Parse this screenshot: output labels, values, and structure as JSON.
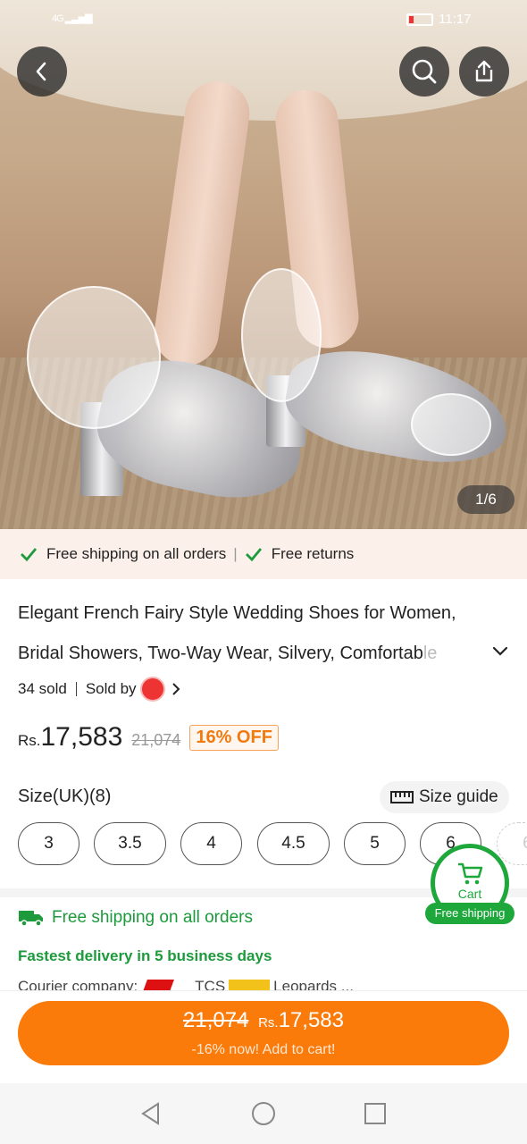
{
  "status_bar": {
    "network": "4G",
    "time": "11:17"
  },
  "gallery": {
    "counter": "1/6"
  },
  "benefits": {
    "shipping": "Free shipping on all orders",
    "separator": "|",
    "returns": "Free returns"
  },
  "product": {
    "title_line1": "Elegant French Fairy Style Wedding Shoes for Women,",
    "title_line2_main": "Bridal Showers, Two-Way Wear, Silvery, Comfortab",
    "title_line2_fade": "le",
    "sold": "34 sold",
    "sold_by": "Sold by"
  },
  "price": {
    "currency": "Rs.",
    "current": "17,583",
    "original": "21,074",
    "discount": "16% OFF"
  },
  "size": {
    "label": "Size(UK)(8)",
    "guide": "Size guide",
    "options": [
      "3",
      "3.5",
      "4",
      "4.5",
      "5",
      "6",
      "6"
    ]
  },
  "shipping": {
    "free": "Free shipping on all orders",
    "fastest": "Fastest delivery in 5 business days",
    "courier_label": "Courier company:",
    "courier_tcs": "TCS",
    "courier_leopards": "Leopards ..."
  },
  "cart_fab": {
    "label": "Cart",
    "badge": "Free shipping"
  },
  "cta": {
    "original": "21,074",
    "currency": "Rs.",
    "price": "17,583",
    "subtitle": "-16% now! Add to cart!"
  },
  "colors": {
    "accent": "#fa7a0a",
    "green": "#1c9a3c",
    "discount": "#f07a10"
  }
}
